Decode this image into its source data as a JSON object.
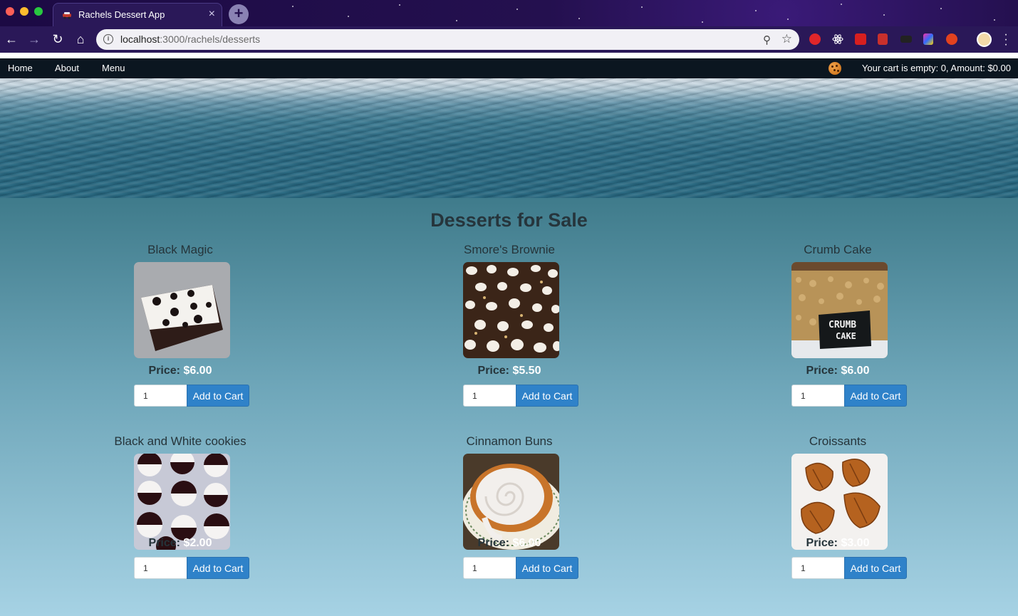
{
  "browser": {
    "tab_title": "Rachels Dessert App",
    "tab_close": "×",
    "new_tab": "+",
    "url_host": "localhost",
    "url_path": ":3000/rachels/desserts"
  },
  "nav": {
    "links": [
      "Home",
      "About",
      "Menu"
    ],
    "cart_status": "Your cart is empty: 0, Amount: $0.00"
  },
  "page": {
    "heading": "Desserts for Sale",
    "price_label": "Price:",
    "add_label": "Add to Cart",
    "default_qty": "1"
  },
  "products": [
    {
      "name": "Black Magic",
      "price": "$6.00"
    },
    {
      "name": "Smore's Brownie",
      "price": "$5.50"
    },
    {
      "name": "Crumb Cake",
      "price": "$6.00"
    },
    {
      "name": "Black and White cookies",
      "price": "$2.00"
    },
    {
      "name": "Cinnamon Buns",
      "price": "$6.00"
    },
    {
      "name": "Croissants",
      "price": "$3.00"
    }
  ],
  "photo_text": {
    "crumb_sign": [
      "CRUMB",
      "CAKE"
    ]
  },
  "colors": {
    "nav_bg": "#0b1620",
    "button": "#2f82c9",
    "browser_bg": "#24104f"
  }
}
